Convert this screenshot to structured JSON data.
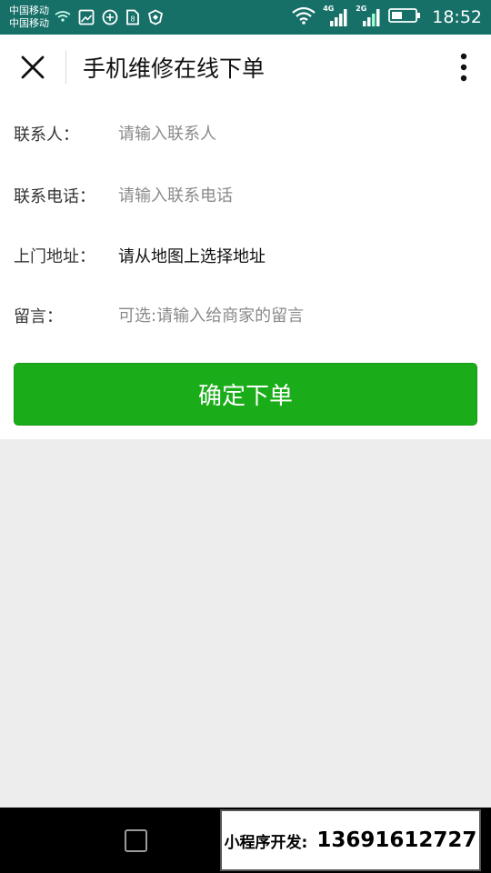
{
  "status_bar": {
    "carrier_1": "中国移动",
    "carrier_2": "中国移动",
    "net_type_1": "4G",
    "net_type_2": "2G",
    "time": "18:52",
    "icons": [
      "wifi-calling-icon",
      "image-icon",
      "vpn-icon",
      "sim-icon",
      "shield-icon",
      "wifi-icon",
      "signal-icon",
      "battery-icon"
    ]
  },
  "header": {
    "title": "手机维修在线下单",
    "close_icon": "close-icon",
    "more_icon": "more-vertical-icon"
  },
  "form": {
    "contact_name": {
      "label": "联系人：",
      "placeholder": "请输入联系人",
      "value": ""
    },
    "contact_phone": {
      "label": "联系电话：",
      "placeholder": "请输入联系电话",
      "value": ""
    },
    "address": {
      "label": "上门地址：",
      "value": "请从地图上选择地址"
    },
    "message": {
      "label": "留言：",
      "placeholder": "可选:请输入给商家的留言",
      "value": ""
    },
    "submit_label": "确定下单"
  },
  "nav_bar": {
    "recents_icon": "square-recents-icon"
  },
  "promo": {
    "label": "小程序开发:",
    "phone": "13691612727"
  },
  "colors": {
    "status_bar": "#167068",
    "primary_button": "#1aad19",
    "page_background": "#ededed"
  }
}
